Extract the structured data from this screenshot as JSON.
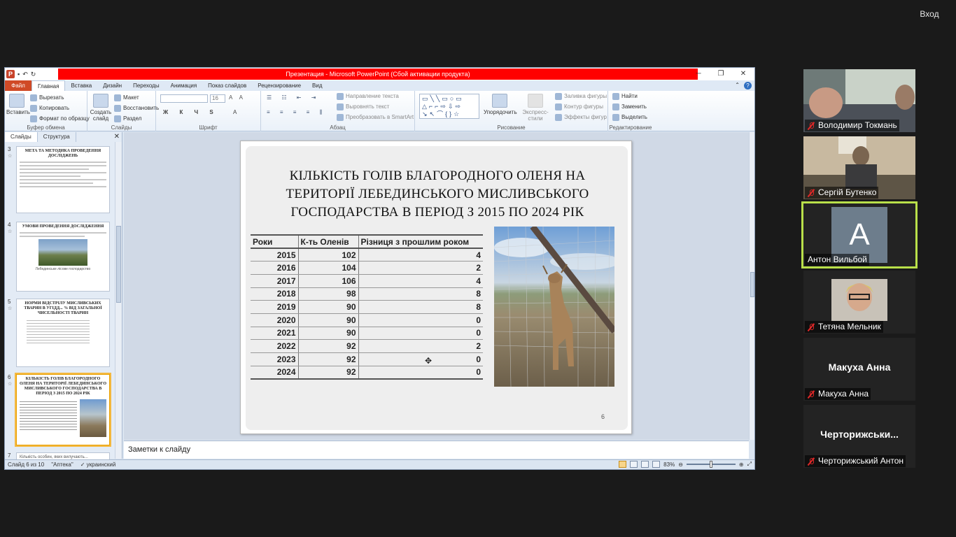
{
  "top_right": {
    "login_label": "Вход"
  },
  "window": {
    "title": "Презентация - Microsoft PowerPoint (Сбой активации продукта)",
    "tabs": [
      "Файл",
      "Главная",
      "Вставка",
      "Дизайн",
      "Переходы",
      "Анимация",
      "Показ слайдов",
      "Рецензирование",
      "Вид"
    ],
    "active_tab": "Главная"
  },
  "ribbon": {
    "clipboard": {
      "label": "Буфер обмена",
      "paste": "Вставить",
      "cut": "Вырезать",
      "copy": "Копировать",
      "format": "Формат по образцу"
    },
    "slides": {
      "label": "Слайды",
      "new_slide": "Создать слайд",
      "layout": "Макет",
      "reset": "Восстановить",
      "section": "Раздел"
    },
    "font": {
      "label": "Шрифт",
      "size": "16"
    },
    "paragraph": {
      "label": "Абзац",
      "text_direction": "Направление текста",
      "align_text": "Выровнять текст",
      "smartart": "Преобразовать в SmartArt"
    },
    "drawing": {
      "label": "Рисование",
      "arrange": "Упорядочить",
      "quick_styles": "Экспресс-стили",
      "fill": "Заливка фигуры",
      "outline": "Контур фигуры",
      "effects": "Эффекты фигур"
    },
    "editing": {
      "label": "Редактирование",
      "find": "Найти",
      "replace": "Заменить",
      "select": "Выделить"
    }
  },
  "left_panel": {
    "tabs": [
      "Слайды",
      "Структура"
    ],
    "thumbs": [
      {
        "num": "3",
        "title": "МЕТА ТА МЕТОДИКА ПРОВЕДЕННЯ ДОСЛІДЖЕНЬ"
      },
      {
        "num": "4",
        "title": "УМОВИ ПРОВЕДЕННЯ ДОСЛІДЖЕННЯ",
        "caption": "Лебединське лісове господарство"
      },
      {
        "num": "5",
        "title": "НОРМИ ВІДСТРІЛУ МИСЛИВСЬКИХ ТВАРИН В УГІДД... % ВІД ЗАГАЛЬНОЇ ЧИСЕЛЬНОСТІ ТВАРИН"
      },
      {
        "num": "6",
        "title": "КІЛЬКІСТЬ ГОЛІВ БЛАГОРОДНОГО ОЛЕНЯ НА ТЕРИТОРІЇ ЛЕБЕДИНСЬКОГО МИСЛИВСЬКОГО ГОСПОДАРСТВА В ПЕРІОД З 2015 ПО 2024 РІК"
      },
      {
        "num": "7",
        "title": "Кількість особин, яких вилучають..."
      }
    ]
  },
  "slide": {
    "title": "КІЛЬКІСТЬ ГОЛІВ БЛАГОРОДНОГО ОЛЕНЯ НА ТЕРИТОРІЇ ЛЕБЕДИНСЬКОГО МИСЛИВСЬКОГО ГОСПОДАРСТВА В ПЕРІОД З 2015 ПО 2024 РІК",
    "number": "6",
    "table": {
      "headers": [
        "Роки",
        "К-ть Оленів",
        "Різниця з прошлим роком"
      ],
      "rows": [
        [
          "2015",
          "102",
          "4"
        ],
        [
          "2016",
          "104",
          "2"
        ],
        [
          "2017",
          "106",
          "4"
        ],
        [
          "2018",
          "98",
          "8"
        ],
        [
          "2019",
          "90",
          "8"
        ],
        [
          "2020",
          "90",
          "0"
        ],
        [
          "2021",
          "90",
          "0"
        ],
        [
          "2022",
          "92",
          "2"
        ],
        [
          "2023",
          "92",
          "0"
        ],
        [
          "2024",
          "92",
          "0"
        ]
      ]
    }
  },
  "notes_placeholder": "Заметки к слайду",
  "status": {
    "slide_info": "Слайд 6 из 10",
    "theme": "\"Аптека\"",
    "language": "украинский",
    "zoom": "83%"
  },
  "participants": [
    {
      "name": "Володимир Токмань",
      "muted": true
    },
    {
      "name": "Сергій Бутенко",
      "muted": true
    },
    {
      "name": "Антон Вильбой",
      "muted": false,
      "avatar_letter": "A"
    },
    {
      "name": "Тетяна Мельник",
      "muted": true
    },
    {
      "name": "Макуха Анна",
      "muted": true,
      "big": "Макуха Анна"
    },
    {
      "name": "Черторижський Антон",
      "muted": true,
      "big": "Черторижськи..."
    }
  ],
  "colors": {
    "title_bar_red": "#ff0000",
    "file_tab": "#d04a26",
    "active_speaker": "#b9e04a"
  }
}
